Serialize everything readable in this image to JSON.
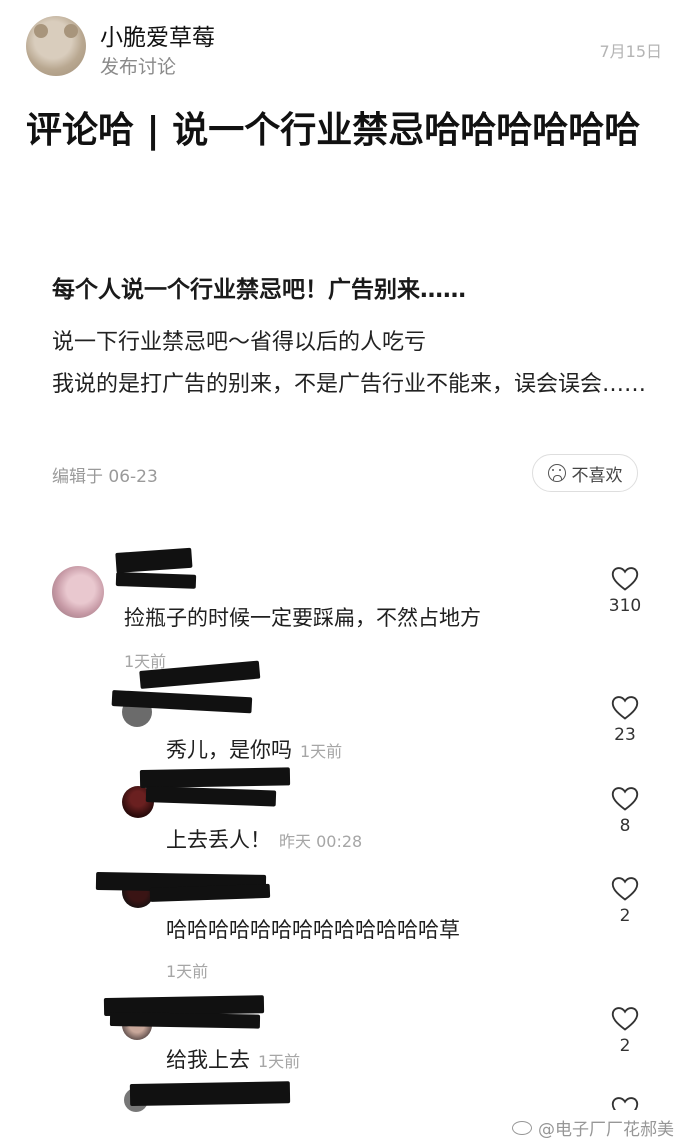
{
  "post": {
    "author_name": "小脆爱草莓",
    "action": "发布讨论",
    "date": "7月15日",
    "title": "评论哈 | 说一个行业禁忌哈哈哈哈哈哈"
  },
  "quoted": {
    "title": "每个人说一个行业禁忌吧！广告别来……",
    "body_line1": "说一下行业禁忌吧～省得以后的人吃亏",
    "body_line2": "我说的是打广告的别来，不是广告行业不能来，误会误会……",
    "edited": "编辑于 06-23",
    "dislike_label": "不喜欢"
  },
  "comments": [
    {
      "text": "捡瓶子的时候一定要踩扁，不然占地方",
      "time": "1天前",
      "likes": "310"
    },
    {
      "text": "秀儿，是你吗",
      "time": "1天前",
      "likes": "23"
    },
    {
      "text": "上去丢人！",
      "time": "昨天 00:28",
      "likes": "8"
    },
    {
      "text": "哈哈哈哈哈哈哈哈哈哈哈哈哈草",
      "time": "1天前",
      "likes": "2"
    },
    {
      "text": "给我上去",
      "time": "1天前",
      "likes": "2"
    }
  ],
  "watermark": "@电子厂厂花郝美",
  "icons": [
    "heart-outline-icon",
    "sad-face-icon",
    "weibo-icon"
  ],
  "colors": {
    "text": "#1a1a1a",
    "muted": "#a6a6a6",
    "redaction": "#111111"
  }
}
